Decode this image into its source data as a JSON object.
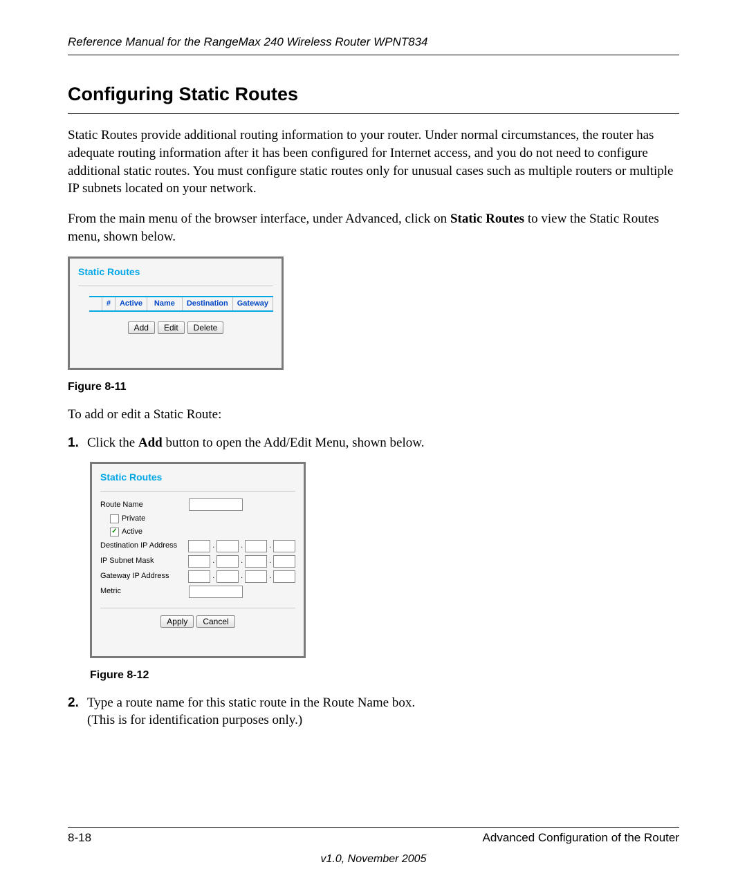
{
  "header": {
    "running_title": "Reference Manual for the RangeMax 240 Wireless Router WPNT834"
  },
  "section_title": "Configuring Static Routes",
  "body_p1": "Static Routes provide additional routing information to your router. Under normal circumstances, the router has adequate routing information after it has been configured for Internet access, and you do not need to configure additional static routes. You must configure static routes only for unusual cases such as multiple routers or multiple IP subnets located on your network.",
  "body_p2a": "From the main menu of the browser interface, under Advanced, click on ",
  "body_p2_bold": "Static Routes",
  "body_p2b": " to view the Static Routes menu, shown below.",
  "figure1": {
    "title": "Static Routes",
    "columns": {
      "hash": "#",
      "active": "Active",
      "name": "Name",
      "destination": "Destination",
      "gateway": "Gateway"
    },
    "buttons": {
      "add": "Add",
      "edit": "Edit",
      "delete": "Delete"
    },
    "caption": "Figure 8-11"
  },
  "intro_step_text": "To add or edit a Static Route:",
  "steps": {
    "s1_num": "1.",
    "s1a": "Click the ",
    "s1_bold": "Add",
    "s1b": " button to open the Add/Edit Menu, shown below.",
    "s2_num": "2.",
    "s2a": "Type a route name for this static route in the Route Name box.",
    "s2b": "(This is for identification purposes only.)"
  },
  "figure2": {
    "title": "Static Routes",
    "labels": {
      "route_name": "Route Name",
      "private": "Private",
      "active": "Active",
      "dest_ip": "Destination IP Address",
      "subnet": "IP Subnet Mask",
      "gw_ip": "Gateway IP Address",
      "metric": "Metric"
    },
    "private_checked": false,
    "active_checked": true,
    "checkmark": "✓",
    "buttons": {
      "apply": "Apply",
      "cancel": "Cancel"
    },
    "caption": "Figure 8-12"
  },
  "footer": {
    "page_num": "8-18",
    "chapter": "Advanced Configuration of the Router",
    "version": "v1.0, November 2005"
  }
}
